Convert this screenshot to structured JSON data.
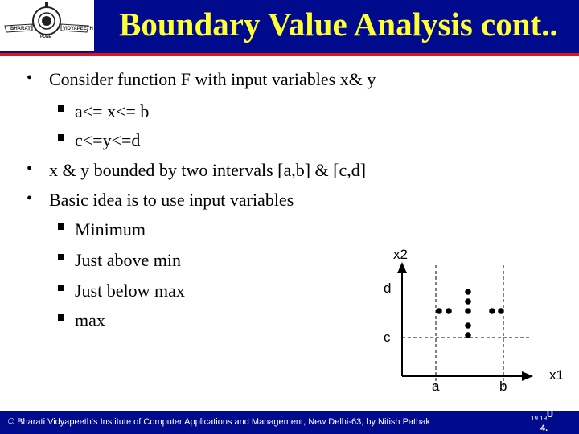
{
  "header": {
    "title": "Boundary Value Analysis cont..",
    "logo": {
      "left_text": "BHARATI",
      "right_text": "VIDYAPEETH",
      "bottom_text": "PUNE",
      "icon": "bharati-vidyapeeth-emblem-icon"
    }
  },
  "bullets": [
    {
      "text": "Consider function F with input variables x& y",
      "sub": [
        "a<= x<= b",
        "c<=y<=d"
      ]
    },
    {
      "text": "x & y  bounded by two intervals [a,b] & [c,d]",
      "sub": []
    },
    {
      "text": "Basic idea is to use input variables",
      "sub": [
        "Minimum",
        "Just above min",
        "Just below max",
        "max"
      ]
    }
  ],
  "diagram": {
    "x_axis_label": "x1",
    "y_axis_label": "x2",
    "x_ticks": [
      "a",
      "b"
    ],
    "y_ticks": [
      "c",
      "d"
    ],
    "points_description": "Boundary value test points: x1 at min, min+, nom, max-, max with x2 nominal; x2 at min, min+, nom, max-, max with x1 nominal",
    "points": [
      {
        "x1": "min",
        "x2": "nom"
      },
      {
        "x1": "min+",
        "x2": "nom"
      },
      {
        "x1": "nom",
        "x2": "nom"
      },
      {
        "x1": "max-",
        "x2": "nom"
      },
      {
        "x1": "max",
        "x2": "nom"
      },
      {
        "x1": "nom",
        "x2": "max+"
      },
      {
        "x1": "nom",
        "x2": "max-"
      },
      {
        "x1": "nom",
        "x2": "min+"
      },
      {
        "x1": "nom",
        "x2": "min"
      }
    ]
  },
  "footer": {
    "text": "© Bharati Vidyapeeth's Institute of Computer Applications and Management, New Delhi-63, by  Nitish Pathak",
    "page_small": "19 19",
    "page_u": "U",
    "page_line2": "4."
  },
  "colors": {
    "header_bg": "#000a8c",
    "title": "#ffff33",
    "accent_red": "#e0141e",
    "footer_bg": "#000a8c"
  }
}
